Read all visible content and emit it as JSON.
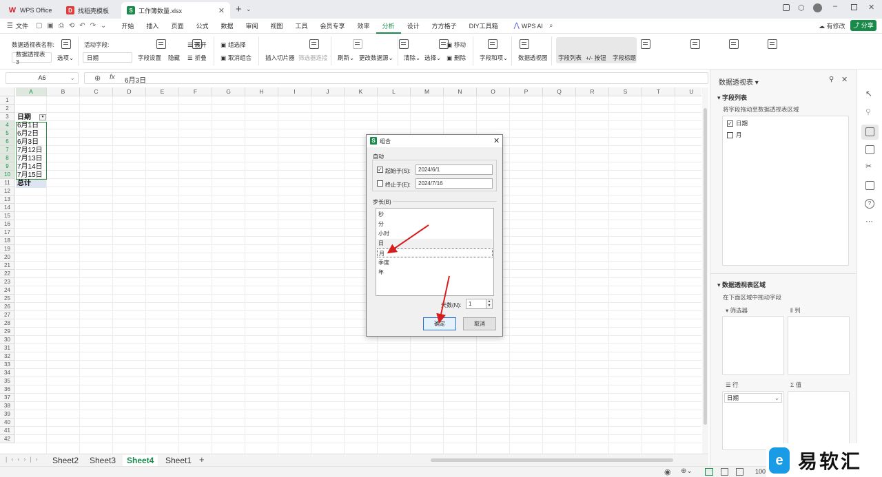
{
  "tabs": [
    {
      "label": "WPS Office",
      "icon": "wps-logo-icon"
    },
    {
      "label": "找稻壳模板",
      "icon": "docer-icon"
    },
    {
      "label": "工作簿数量.xlsx",
      "icon": "spreadsheet-icon"
    }
  ],
  "menu": {
    "file": "文件",
    "items": [
      "开始",
      "插入",
      "页面",
      "公式",
      "数据",
      "审阅",
      "视图",
      "工具",
      "会员专享",
      "效率",
      "分析",
      "设计",
      "方方格子",
      "DIY工具箱"
    ],
    "active": "分析",
    "wps_ai": "WPS AI",
    "has_changes": "有修改",
    "share": "分享"
  },
  "ribbon": {
    "pivot_name_label": "数据透视表名称:",
    "pivot_name_value": "数据透视表3",
    "options": "选项",
    "active_field_label": "活动字段:",
    "active_field_value": "日期",
    "field_settings": "字段设置",
    "hide": "隐藏",
    "expand": "展开",
    "collapse": "折叠",
    "group_selection": "组选择",
    "ungroup": "取消组合",
    "insert_slicer": "插入切片器",
    "filter_connections": "筛选器连接",
    "refresh": "刷新",
    "change_source": "更改数据源",
    "clear": "清除",
    "select": "选择",
    "move": "移动",
    "delete": "删除",
    "fields_items": "字段和项",
    "pivot_chart": "数据透视图",
    "field_list": "字段列表",
    "buttons": "+/- 按钮",
    "field_headers": "字段标题"
  },
  "formula_bar": {
    "cell_ref": "A6",
    "fx": "fx",
    "value": "6月3日"
  },
  "columns": [
    "A",
    "B",
    "C",
    "D",
    "E",
    "F",
    "G",
    "H",
    "I",
    "J",
    "K",
    "L",
    "M",
    "N",
    "O",
    "P",
    "Q",
    "R",
    "S",
    "T",
    "U"
  ],
  "rows": [
    "1",
    "2",
    "3",
    "4",
    "5",
    "6",
    "7",
    "8",
    "9",
    "10",
    "11",
    "12",
    "13",
    "14",
    "15",
    "16",
    "17",
    "18",
    "19",
    "20",
    "21",
    "22",
    "23",
    "24",
    "25",
    "26",
    "27",
    "28",
    "29",
    "30",
    "31",
    "32",
    "33",
    "34",
    "35",
    "36",
    "37",
    "38",
    "39",
    "40",
    "41",
    "42"
  ],
  "cells": {
    "header": "日期",
    "dates": [
      "6月1日",
      "6月2日",
      "6月3日",
      "7月12日",
      "7月13日",
      "7月14日",
      "7月15日"
    ],
    "total": "总计"
  },
  "sheets": [
    "Sheet2",
    "Sheet3",
    "Sheet4",
    "Sheet1"
  ],
  "active_sheet": "Sheet4",
  "panel": {
    "title": "数据透视表",
    "field_list_header": "字段列表",
    "field_list_hint": "将字段拖动至数据透视表区域",
    "fields": [
      {
        "label": "日期",
        "checked": true
      },
      {
        "label": "月",
        "checked": false
      }
    ],
    "areas_header": "数据透视表区域",
    "areas_hint": "在下面区域中拖动字段",
    "filters": "筛选器",
    "columns": "列",
    "rows": "行",
    "values": "值",
    "row_field": "日期"
  },
  "dialog": {
    "title": "组合",
    "auto_label": "自动",
    "start_label": "起始于(S):",
    "start_value": "2024/6/1",
    "start_checked": true,
    "end_label": "终止于(E):",
    "end_value": "2024/7/16",
    "end_checked": false,
    "step_label": "步长(B)",
    "step_items": [
      "秒",
      "分",
      "小时",
      "日",
      "月",
      "季度",
      "年"
    ],
    "selected": [
      "日",
      "月"
    ],
    "days_label": "天数(N):",
    "days_value": "1",
    "ok": "确定",
    "cancel": "取消"
  },
  "status": {
    "zoom": "100"
  },
  "watermark": "易软汇"
}
